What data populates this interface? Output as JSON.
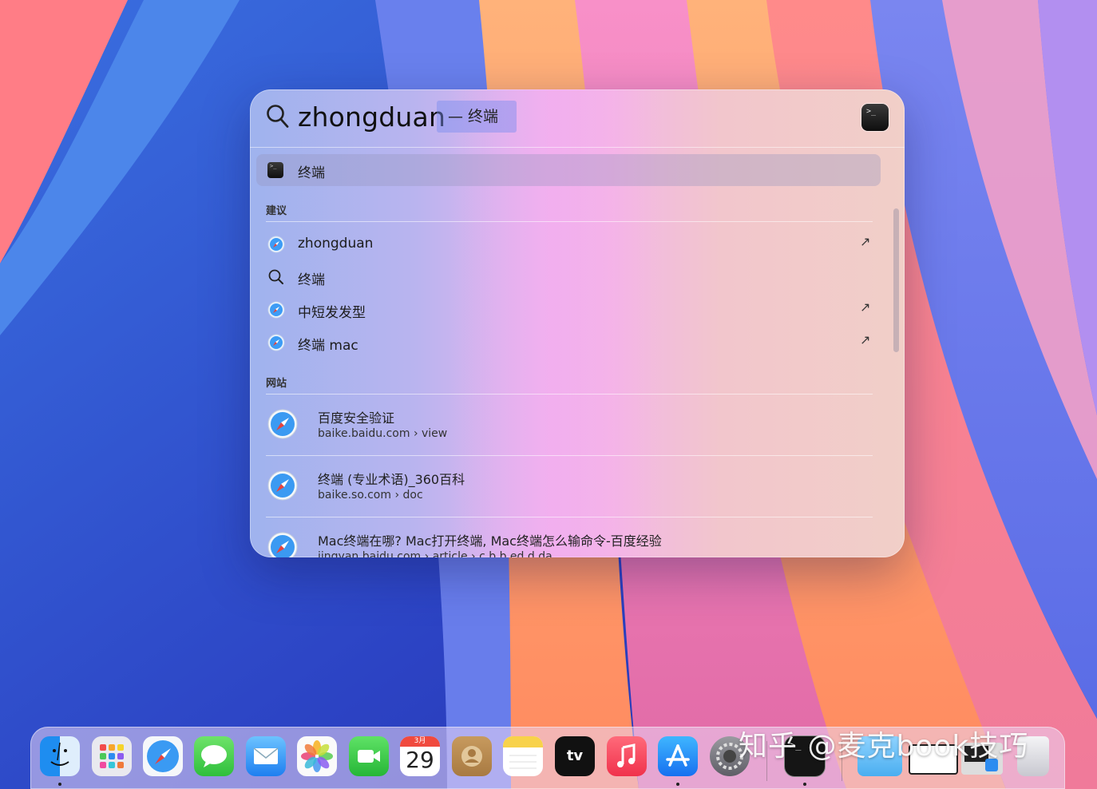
{
  "search": {
    "query": "zhongduan",
    "completion": "— 终端",
    "top_hit_icon": "terminal-icon"
  },
  "top_hit": {
    "label": "终端",
    "icon": "terminal-icon"
  },
  "suggestions": {
    "title": "建议",
    "items": [
      {
        "label": "zhongduan",
        "icon": "safari-icon",
        "arrow": "↗"
      },
      {
        "label": "终端",
        "icon": "magnifier-icon",
        "arrow": ""
      },
      {
        "label": "中短发发型",
        "icon": "safari-icon",
        "arrow": "↗"
      },
      {
        "label": "终端 mac",
        "icon": "safari-icon",
        "arrow": "↗"
      }
    ]
  },
  "websites": {
    "title": "网站",
    "items": [
      {
        "title": "百度安全验证",
        "url": "baike.baidu.com › view"
      },
      {
        "title": "终端 (专业术语)_360百科",
        "url": "baike.so.com › doc"
      },
      {
        "title": "Mac终端在哪? Mac打开终端, Mac终端怎么输命令-百度经验",
        "url": "jingyan.baidu.com › article › c b b ed d da"
      }
    ]
  },
  "watermark": "知乎 @麦克book技巧",
  "dock": {
    "calendar_month": "3月",
    "calendar_day": "29",
    "tv_label": "tv",
    "items": [
      "finder-icon",
      "launchpad-icon",
      "safari-icon",
      "messages-icon",
      "mail-icon",
      "photos-icon",
      "facetime-icon",
      "calendar-icon",
      "contacts-icon",
      "notes-icon",
      "appletv-icon",
      "music-icon",
      "appstore-icon",
      "settings-icon",
      "terminal-icon",
      "folder-icon",
      "window-icon",
      "installer-icon",
      "trash-icon"
    ]
  }
}
